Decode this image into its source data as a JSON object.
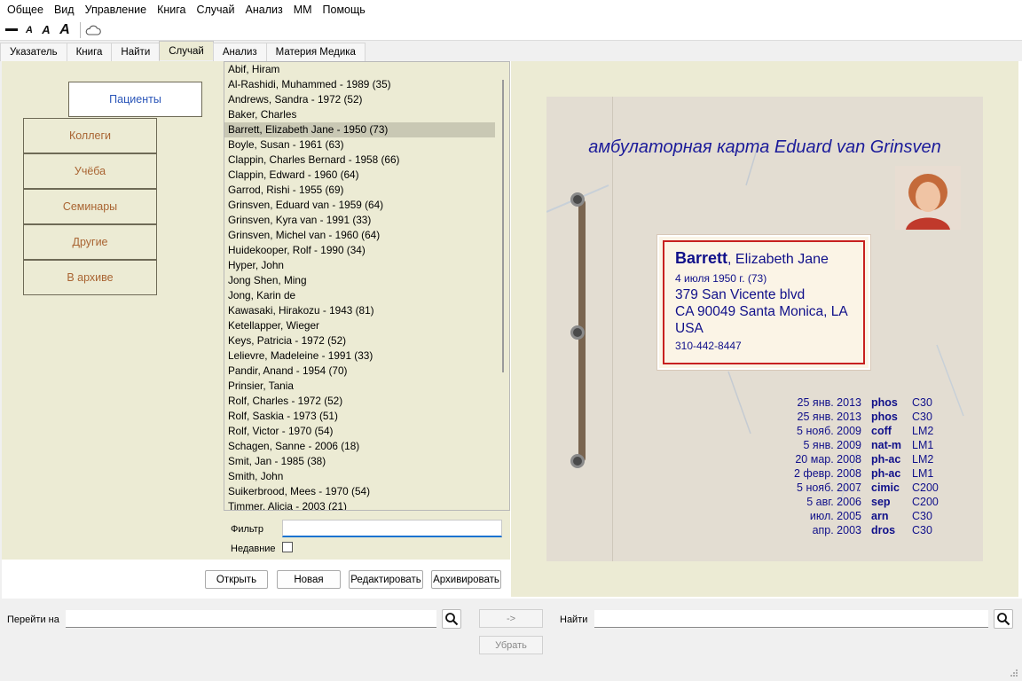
{
  "menu": [
    "Общее",
    "Вид",
    "Управление",
    "Книга",
    "Случай",
    "Анализ",
    "ММ",
    "Помощь"
  ],
  "toolbar": {
    "font_small_1": "A",
    "font_small_2": "A",
    "font_large": "A",
    "icons": [
      "minus-icon",
      "font-smaller-icon",
      "font-medium-icon",
      "font-larger-icon",
      "cloud-icon"
    ]
  },
  "tabs": [
    "Указатель",
    "Книга",
    "Найти",
    "Случай",
    "Анализ",
    "Материя Медика"
  ],
  "active_tab": "Случай",
  "categories": [
    "Пациенты",
    "Коллеги",
    "Учёба",
    "Семинары",
    "Другие",
    "В архиве"
  ],
  "patients": [
    "Abif, Hiram",
    "Al-Rashidi, Muhammed - 1989 (35)",
    "Andrews, Sandra - 1972 (52)",
    "Baker, Charles",
    "Barrett, Elizabeth Jane - 1950 (73)",
    "Boyle, Susan - 1961 (63)",
    "Clappin, Charles Bernard - 1958 (66)",
    "Clappin, Edward - 1960 (64)",
    "Garrod, Rishi - 1955 (69)",
    "Grinsven, Eduard van - 1959 (64)",
    "Grinsven, Kyra van - 1991 (33)",
    "Grinsven, Michel van - 1960 (64)",
    "Huidekooper, Rolf - 1990 (34)",
    "Hyper, John",
    "Jong Shen, Ming",
    "Jong, Karin de",
    "Kawasaki, Hirakozu - 1943 (81)",
    "Ketellapper, Wieger",
    "Keys, Patricia - 1972 (52)",
    "Lelievre, Madeleine - 1991 (33)",
    "Pandir, Anand - 1954 (70)",
    "Prinsier, Tania",
    "Rolf, Charles - 1972 (52)",
    "Rolf, Saskia - 1973 (51)",
    "Rolf, Victor - 1970 (54)",
    "Schagen, Sanne - 2006 (18)",
    "Smit, Jan - 1985 (38)",
    "Smith, John",
    "Suikerbrood, Mees - 1970 (54)",
    "Timmer, Alicia - 2003 (21)"
  ],
  "selected_patient": "Barrett, Elizabeth Jane - 1950 (73)",
  "filter": {
    "label": "Фильтр",
    "value": "",
    "recent_label": "Недавние",
    "recent_checked": false
  },
  "actions": {
    "open": "Открыть",
    "new": "Новая",
    "edit": "Редактировать",
    "archive": "Архивировать"
  },
  "card": {
    "title": "амбулаторная карта Eduard van Grinsven",
    "surname": "Barrett",
    "given_names": ", Elizabeth Jane",
    "birth": "4 июля 1950 г. (73)",
    "street": "379 San Vicente blvd",
    "city": "CA 90049  Santa Monica, LA",
    "country": "USA",
    "phone": "310-442-8447",
    "visits": [
      {
        "date": "25 янв. 2013",
        "remedy": "phos",
        "potency": "C30"
      },
      {
        "date": "25 янв. 2013",
        "remedy": "phos",
        "potency": "C30"
      },
      {
        "date": "5 нояб. 2009",
        "remedy": "coff",
        "potency": "LM2"
      },
      {
        "date": "5 янв. 2009",
        "remedy": "nat-m",
        "potency": "LM1"
      },
      {
        "date": "20 мар. 2008",
        "remedy": "ph-ac",
        "potency": "LM2"
      },
      {
        "date": "2 февр. 2008",
        "remedy": "ph-ac",
        "potency": "LM1"
      },
      {
        "date": "5 нояб. 2007",
        "remedy": "cimic",
        "potency": "C200"
      },
      {
        "date": "5 авг. 2006",
        "remedy": "sep",
        "potency": "C200"
      },
      {
        "date": "июл. 2005",
        "remedy": "arn",
        "potency": "C30"
      },
      {
        "date": "апр. 2003",
        "remedy": "dros",
        "potency": "C30"
      }
    ],
    "colors": {
      "ink": "#10108a",
      "frame": "#c72020",
      "paper": "#e3ddd2"
    }
  },
  "bottom": {
    "goto_label": "Перейти на",
    "goto_value": "",
    "arrow_label": "->",
    "find_label": "Найти",
    "find_value": "",
    "remove_label": "Убрать"
  }
}
